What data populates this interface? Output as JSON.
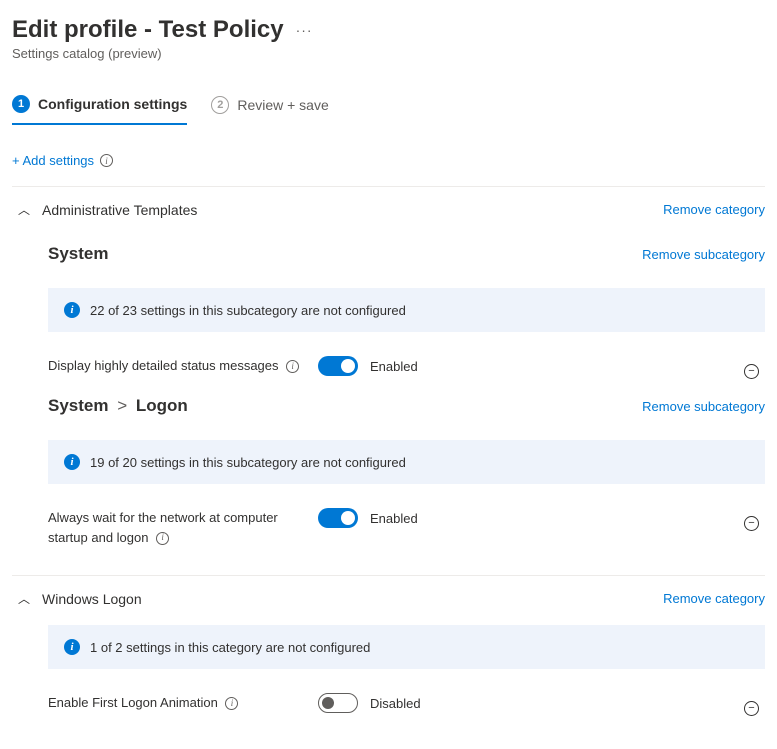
{
  "header": {
    "title": "Edit profile - Test Policy",
    "subtitle": "Settings catalog (preview)"
  },
  "tabs": {
    "step1_num": "1",
    "step1_label": "Configuration settings",
    "step2_num": "2",
    "step2_label": "Review + save"
  },
  "actions": {
    "add_settings": "+ Add settings",
    "remove_category": "Remove category",
    "remove_subcategory": "Remove subcategory"
  },
  "categories": {
    "admin_templates": {
      "title": "Administrative Templates",
      "sub_system": {
        "title": "System",
        "info": "22 of 23 settings in this subcategory are not configured",
        "setting_label": "Display highly detailed status messages",
        "setting_state": "Enabled"
      },
      "sub_logon": {
        "title_part1": "System",
        "title_sep": ">",
        "title_part2": "Logon",
        "info": "19 of 20 settings in this subcategory are not configured",
        "setting_label": "Always wait for the network at computer startup and logon",
        "setting_state": "Enabled"
      }
    },
    "windows_logon": {
      "title": "Windows Logon",
      "info": "1 of 2 settings in this category are not configured",
      "setting_label": "Enable First Logon Animation",
      "setting_state": "Disabled"
    }
  }
}
